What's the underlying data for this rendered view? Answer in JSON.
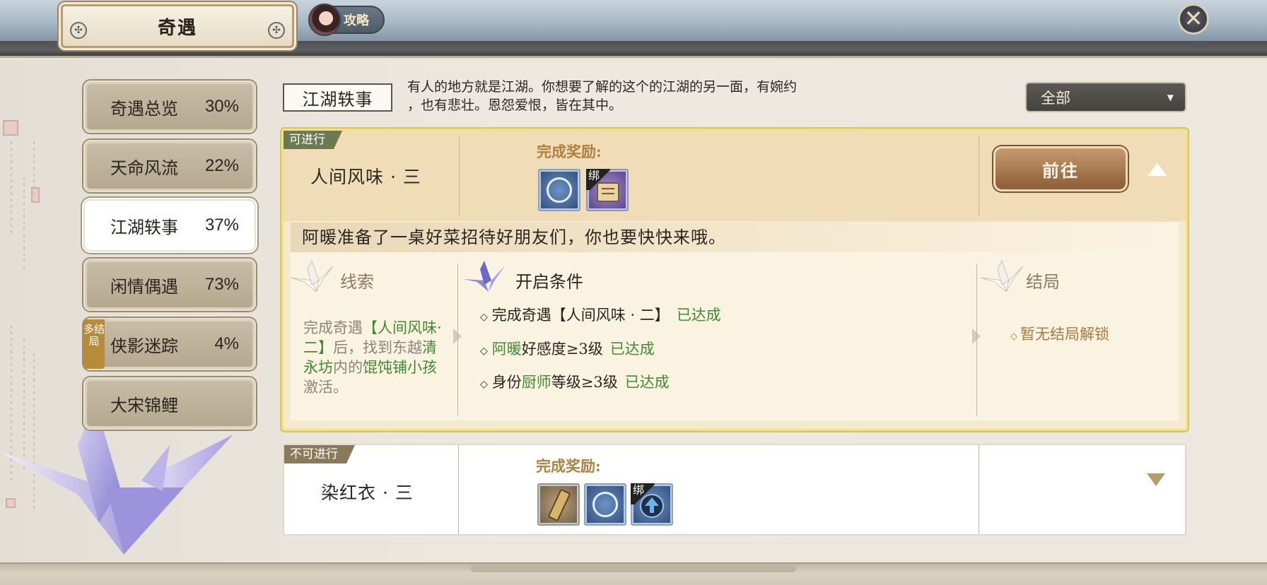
{
  "header": {
    "title": "奇遇",
    "guide_label": "攻略",
    "close_symbol": "✕"
  },
  "sidebar": {
    "items": [
      {
        "label": "奇遇总览",
        "percent": "30%"
      },
      {
        "label": "天命风流",
        "percent": "22%"
      },
      {
        "label": "江湖轶事",
        "percent": "37%",
        "active": true
      },
      {
        "label": "闲情偶遇",
        "percent": "73%"
      },
      {
        "label": "侠影迷踪",
        "percent": "4%",
        "badge": "多结局"
      },
      {
        "label": "大宋锦鲤",
        "percent": ""
      }
    ]
  },
  "section": {
    "title": "江湖轶事",
    "description_line1": "有人的地方就是江湖。你想要了解的这个的江湖的另一面，有婉约",
    "description_line2": "，也有悲壮。恩怨爱恨，皆在其中。"
  },
  "filter": {
    "selected": "全部",
    "arrow": "▼"
  },
  "quests": [
    {
      "status": "可进行",
      "name": "人间风味 · 三",
      "reward_label": "完成奖励:",
      "bind_label": "绑",
      "go_label": "前往",
      "intro": "阿暖准备了一桌好菜招待好朋友们，你也要快快来哦。",
      "clue_title": "线索",
      "clue": {
        "p1": "完成奇遇",
        "p2": "【人间风味·二】",
        "p3": "后，找到东越",
        "p4": "清永坊",
        "p5": "内的",
        "p6": "馄饨铺小孩",
        "p7": "激活。"
      },
      "conditions_title": "开启条件",
      "conditions": [
        {
          "a": "完成奇遇【人间风味 · 二】",
          "g": "",
          "b": "",
          "status": "已达成"
        },
        {
          "a": "",
          "g": "阿暖",
          "b": "好感度≥3级",
          "status": "已达成"
        },
        {
          "a": "身份",
          "g": "厨师",
          "b": "等级≥3级",
          "status": "已达成"
        }
      ],
      "ending_title": "结局",
      "ending": "暂无结局解锁"
    },
    {
      "status": "不可进行",
      "name": "染红衣 · 三",
      "reward_label": "完成奖励:",
      "bind_label": "绑"
    }
  ],
  "icons": {
    "diamond": "◇"
  }
}
